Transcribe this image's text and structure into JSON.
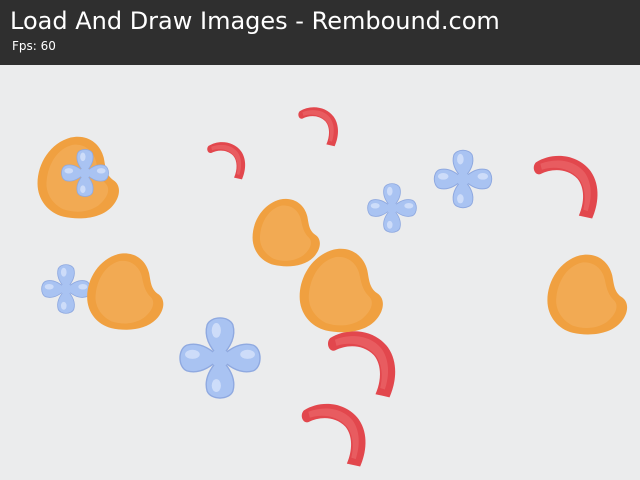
{
  "header": {
    "title": "Load And Draw Images - Rembound.com",
    "fps_label": "Fps:",
    "fps_value": "60"
  },
  "sprites": {
    "types": [
      {
        "name": "orange-blob",
        "color": "#f0a040"
      },
      {
        "name": "blue-flower",
        "color": "#a9c3f2"
      },
      {
        "name": "red-worm",
        "color": "#e2474d"
      }
    ],
    "count": 16
  },
  "colors": {
    "background": "#ebeced",
    "header_bar": "#2f2f2f",
    "header_text": "#ffffff"
  }
}
